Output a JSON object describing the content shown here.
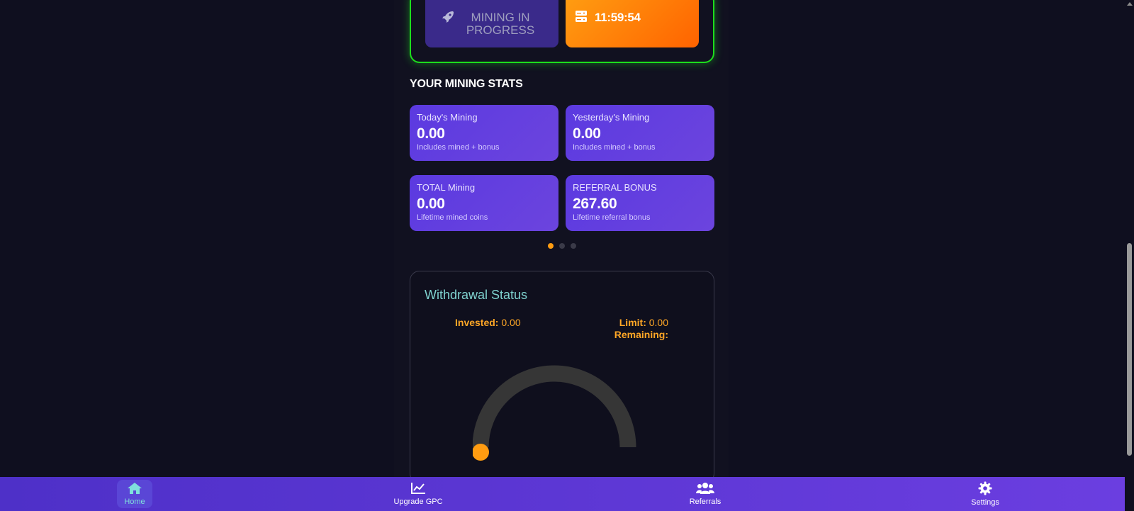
{
  "mining": {
    "status_label": "MINING IN PROGRESS",
    "timer": "11:59:54"
  },
  "stats_section": {
    "title": "YOUR MINING STATS",
    "cards": [
      {
        "title": "Today's Mining",
        "value": "0.00",
        "sub": "Includes mined + bonus"
      },
      {
        "title": "Yesterday's Mining",
        "value": "0.00",
        "sub": "Includes mined + bonus"
      },
      {
        "title": "TOTAL Mining",
        "value": "0.00",
        "sub": "Lifetime mined coins"
      },
      {
        "title": "REFERRAL BONUS",
        "value": "267.60",
        "sub": "Lifetime referral bonus"
      }
    ],
    "pager": {
      "total": 3,
      "active": 1
    }
  },
  "withdrawal": {
    "title": "Withdrawal Status",
    "invested_label": "Invested:",
    "invested_value": "0.00",
    "limit_label": "Limit:",
    "limit_value": "0.00",
    "remaining_label": "Remaining:",
    "remaining_value": "",
    "gauge_fraction": 0
  },
  "nav": {
    "items": [
      {
        "label": "Home",
        "icon": "home-icon",
        "active": true
      },
      {
        "label": "Upgrade GPC",
        "icon": "chart-line-icon",
        "active": false
      },
      {
        "label": "Referrals",
        "icon": "users-icon",
        "active": false
      },
      {
        "label": "Settings",
        "icon": "gear-icon",
        "active": false
      }
    ]
  },
  "colors": {
    "background": "#0f0f1f",
    "accent_green": "#1ddd1d",
    "accent_orange": "#ff9c11",
    "card_purple": "#5b3ae0",
    "teal": "#7fd2cf"
  }
}
